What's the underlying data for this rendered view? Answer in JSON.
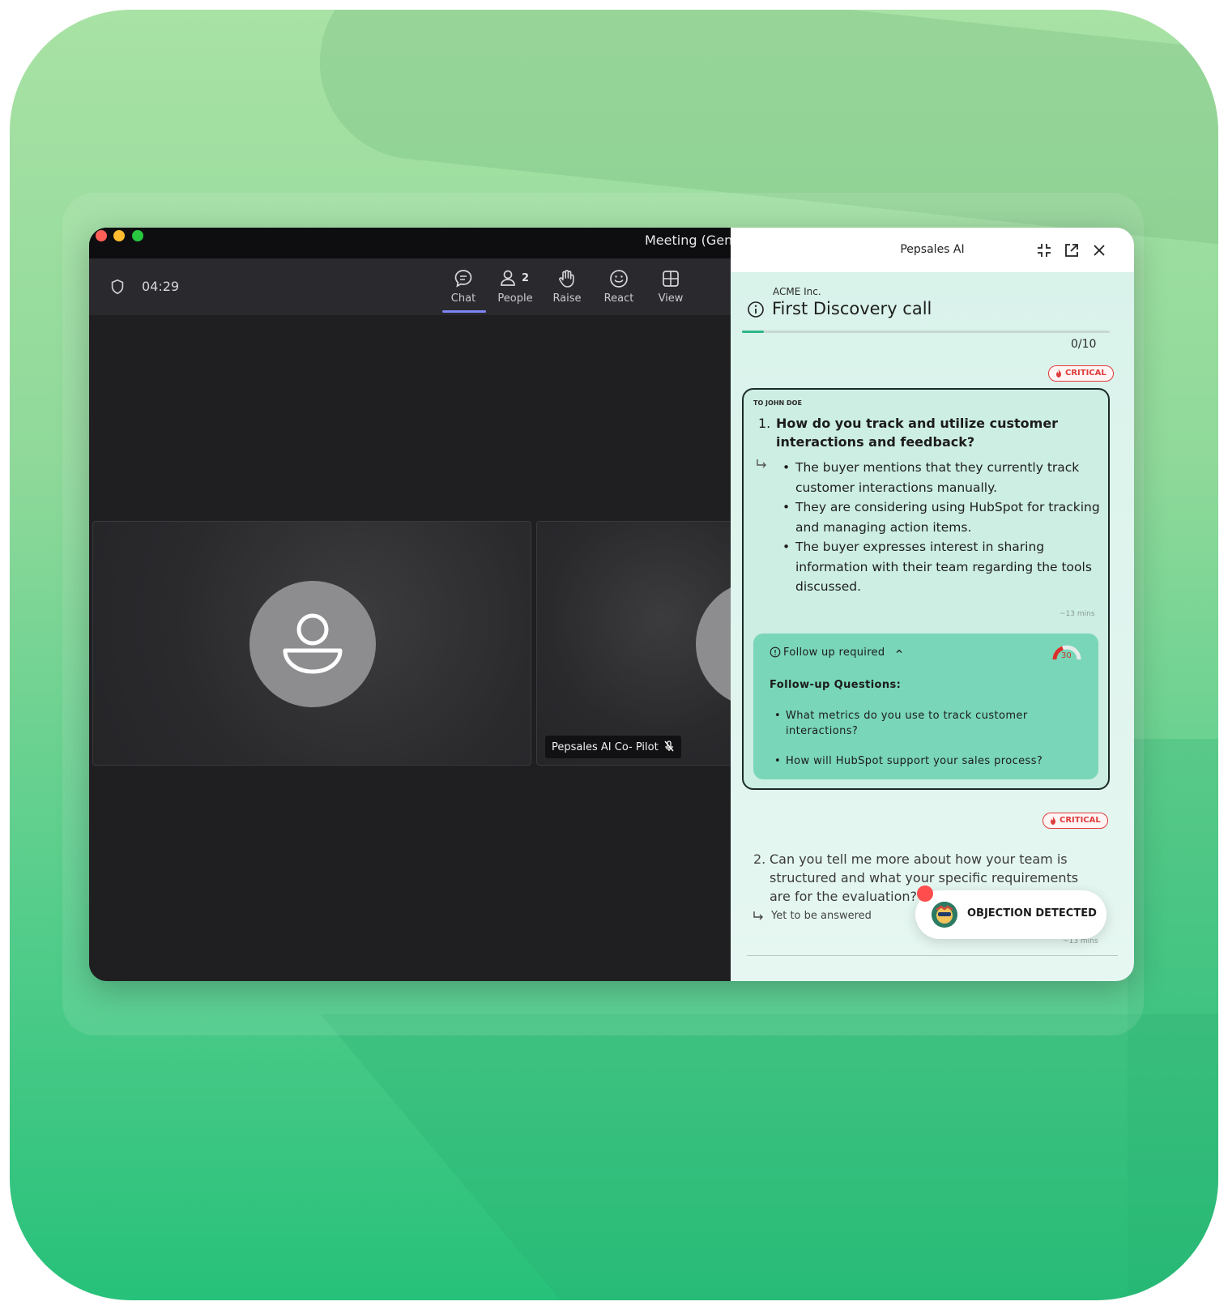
{
  "meeting": {
    "title": "Meeting (Gen",
    "timer": "04:29",
    "toolbar": [
      {
        "label": "Chat",
        "icon": "chat-icon",
        "active": true
      },
      {
        "label": "People",
        "icon": "people-icon",
        "count": "2"
      },
      {
        "label": "Raise",
        "icon": "raise-hand-icon"
      },
      {
        "label": "React",
        "icon": "smiley-icon"
      },
      {
        "label": "View",
        "icon": "view-grid-icon"
      }
    ],
    "participant_tag": "Pepsales AI Co- Pilot"
  },
  "panel": {
    "title": "Pepsales AI",
    "company": "ACME Inc.",
    "call_title": "First Discovery call",
    "progress": {
      "label": "0/10",
      "fraction": 0.06
    },
    "critical_label": "CRITICAL",
    "question1": {
      "to": "TO JOHN DOE",
      "number": "1.",
      "text": "How do you track and utilize customer interactions and feedback?",
      "answers": [
        "The buyer mentions that they currently track customer interactions manually.",
        "They are considering using HubSpot for tracking and managing action items.",
        "The buyer expresses interest in sharing information with their team regarding the tools discussed."
      ],
      "time": "~13 mins",
      "followup": {
        "status": "Follow up required",
        "score": "30",
        "title": "Follow-up Questions:",
        "items": [
          "What metrics do you use to track customer interactions?",
          "How will HubSpot support your sales process?"
        ]
      }
    },
    "question2": {
      "number": "2.",
      "text": "Can you tell me more about how your team is structured and what your specific requirements are for the evaluation?",
      "status": "Yet to be answered",
      "time": "~13 mins"
    },
    "toast": "OBJECTION DETECTED"
  },
  "colors": {
    "accent": "#2fb58a",
    "critical": "#e03b3b",
    "followup_bg": "#79d6b8",
    "teams_active": "#7f85f5"
  }
}
